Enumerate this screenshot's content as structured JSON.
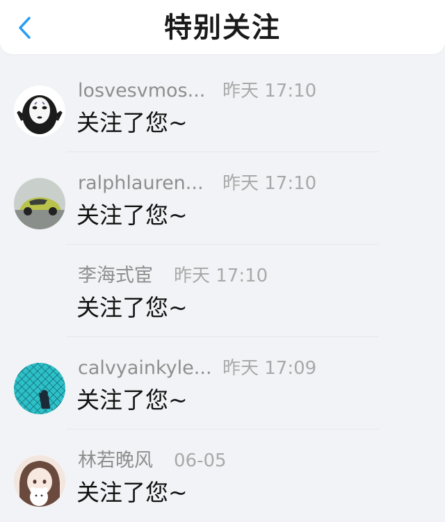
{
  "header": {
    "title": "特别关注",
    "back_icon": "chevron-left-icon",
    "accent": "#2a9df4"
  },
  "notifications": [
    {
      "name": "losvesvmos...",
      "time": "昨天 17:10",
      "message": "关注了您~",
      "avatar": "no-face-mask-avatar"
    },
    {
      "name": "ralphlauren...",
      "time": "昨天 17:10",
      "message": "关注了您~",
      "avatar": "car-photo-avatar"
    },
    {
      "name": "李海式宦",
      "time": "昨天 17:10",
      "message": "关注了您~",
      "avatar": "none"
    },
    {
      "name": "calvyainkyle...",
      "time": "昨天 17:09",
      "message": "关注了您~",
      "avatar": "fence-sky-avatar"
    },
    {
      "name": "林若晚风",
      "time": "06-05",
      "message": "关注了您~",
      "avatar": "anime-girl-bear-avatar"
    }
  ]
}
